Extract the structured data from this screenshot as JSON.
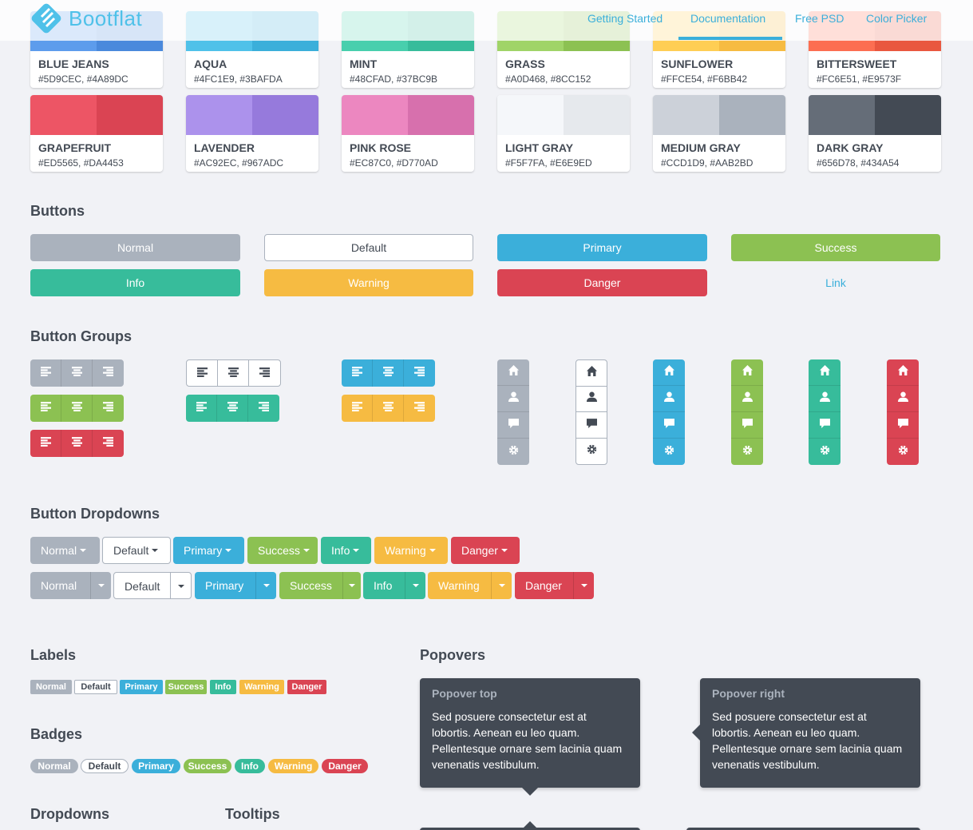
{
  "nav": {
    "brand": "Bootflat",
    "links": [
      "Getting Started",
      "Documentation",
      "Free PSD",
      "Color Picker"
    ],
    "active": "Documentation"
  },
  "colors": [
    {
      "name": "BLUE JEANS",
      "hex": "#5D9CEC, #4A89DC",
      "c1": "#5D9CEC",
      "c2": "#4A89DC"
    },
    {
      "name": "AQUA",
      "hex": "#4FC1E9, #3BAFDA",
      "c1": "#4FC1E9",
      "c2": "#3BAFDA"
    },
    {
      "name": "MINT",
      "hex": "#48CFAD, #37BC9B",
      "c1": "#48CFAD",
      "c2": "#37BC9B"
    },
    {
      "name": "GRASS",
      "hex": "#A0D468, #8CC152",
      "c1": "#A0D468",
      "c2": "#8CC152"
    },
    {
      "name": "SUNFLOWER",
      "hex": "#FFCE54, #F6BB42",
      "c1": "#FFCE54",
      "c2": "#F6BB42"
    },
    {
      "name": "BITTERSWEET",
      "hex": "#FC6E51, #E9573F",
      "c1": "#FC6E51",
      "c2": "#E9573F"
    },
    {
      "name": "GRAPEFRUIT",
      "hex": "#ED5565, #DA4453",
      "c1": "#ED5565",
      "c2": "#DA4453"
    },
    {
      "name": "LAVENDER",
      "hex": "#AC92EC, #967ADC",
      "c1": "#AC92EC",
      "c2": "#967ADC"
    },
    {
      "name": "PINK ROSE",
      "hex": "#EC87C0, #D770AD",
      "c1": "#EC87C0",
      "c2": "#D770AD"
    },
    {
      "name": "LIGHT GRAY",
      "hex": "#F5F7FA, #E6E9ED",
      "c1": "#F5F7FA",
      "c2": "#E6E9ED"
    },
    {
      "name": "MEDIUM GRAY",
      "hex": "#CCD1D9, #AAB2BD",
      "c1": "#CCD1D9",
      "c2": "#AAB2BD"
    },
    {
      "name": "DARK GRAY",
      "hex": "#656D78, #434A54",
      "c1": "#656D78",
      "c2": "#434A54"
    }
  ],
  "sections": {
    "buttons": "Buttons",
    "button_groups": "Button Groups",
    "button_dropdowns": "Button Dropdowns",
    "labels": "Labels",
    "badges": "Badges",
    "dropdowns": "Dropdowns",
    "tooltips": "Tooltips",
    "popovers": "Popovers"
  },
  "buttons": {
    "normal": "Normal",
    "default": "Default",
    "primary": "Primary",
    "success": "Success",
    "info": "Info",
    "warning": "Warning",
    "danger": "Danger",
    "link": "Link"
  },
  "theme": {
    "normal": "#AAB2BD",
    "primary": "#3BAFDA",
    "success": "#8CC152",
    "info": "#37BC9B",
    "warning": "#F6BB42",
    "danger": "#DA4453"
  },
  "icons": {
    "align": [
      "align-left-icon",
      "align-center-icon",
      "align-right-icon"
    ],
    "vertical": [
      "home-icon",
      "user-icon",
      "comment-icon",
      "cog-icon"
    ]
  },
  "popovers": {
    "top": {
      "title": "Popover top",
      "content": "Sed posuere consectetur est at lobortis. Aenean eu leo quam. Pellentesque ornare sem lacinia quam venenatis vestibulum."
    },
    "right": {
      "title": "Popover right",
      "content": "Sed posuere consectetur est at lobortis. Aenean eu leo quam. Pellentesque ornare sem lacinia quam venenatis vestibulum."
    }
  }
}
